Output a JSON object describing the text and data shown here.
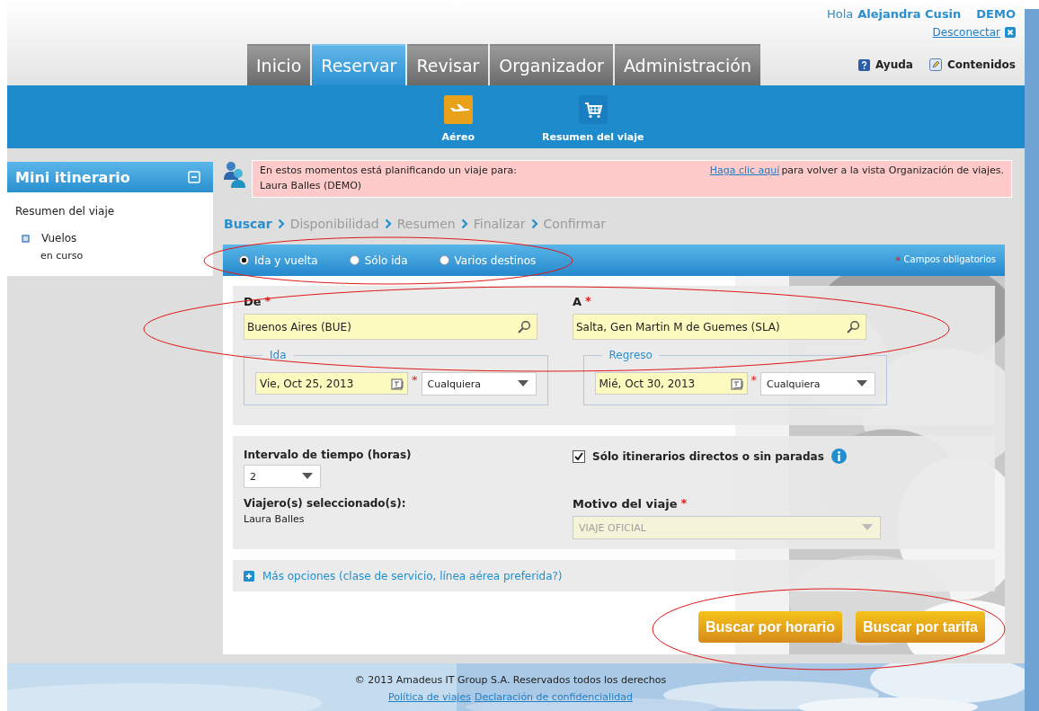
{
  "user": {
    "greeting": "Hola",
    "name": "Alejandra Cusin",
    "company": "DEMO",
    "logout": "Desconectar"
  },
  "tabs": [
    {
      "label": "Inicio",
      "selected": false
    },
    {
      "label": "Reservar",
      "selected": true
    },
    {
      "label": "Revisar",
      "selected": false
    },
    {
      "label": "Organizador",
      "selected": false
    },
    {
      "label": "Administración",
      "selected": false
    }
  ],
  "help_links": [
    {
      "kind": "help",
      "label": "Ayuda"
    },
    {
      "kind": "contents",
      "label": "Contenidos"
    }
  ],
  "subnav": [
    {
      "kind": "flight",
      "label": "Aéreo",
      "selected": true
    },
    {
      "kind": "cart",
      "label": "Resumen del viaje",
      "selected": false
    }
  ],
  "sidebar": {
    "title": "Mini itinerario",
    "summary": "Resumen del viaje",
    "items": [
      {
        "label": "Vuelos",
        "status": "en curso"
      }
    ]
  },
  "notice": {
    "line1": "En estos momentos está planificando un viaje para:",
    "line2": "Laura Balles  (DEMO)",
    "link": "Haga clic  aquí",
    "after": "para volver a la vista Organización de viajes."
  },
  "steps": [
    {
      "label": "Buscar",
      "selected": true
    },
    {
      "label": "Disponibilidad",
      "selected": false
    },
    {
      "label": "Resumen",
      "selected": false
    },
    {
      "label": "Finalizar",
      "selected": false
    },
    {
      "label": "Confirmar",
      "selected": false
    }
  ],
  "trip_types": [
    {
      "label": "Ida y vuelta",
      "selected": true
    },
    {
      "label": "Sólo ida",
      "selected": false
    },
    {
      "label": "Varios destinos",
      "selected": false
    }
  ],
  "required_note": {
    "mark": "*",
    "label": "Campos obligatorios"
  },
  "from": {
    "label": "De",
    "required_mark": "*",
    "value": "Buenos Aires (BUE)"
  },
  "to": {
    "label": "A",
    "required_mark": "*",
    "value": "Salta, Gen Martin M de Guemes (SLA)"
  },
  "legs": [
    {
      "legend": "Ida",
      "date": "Vie, Oct 25, 2013",
      "required_mark": "*",
      "time": "Cualquiera"
    },
    {
      "legend": "Regreso",
      "date": "Mié, Oct 30, 2013",
      "required_mark": "*",
      "time": "Cualquiera"
    }
  ],
  "interval": {
    "label": "Intervalo de tiempo (horas)",
    "value": "2"
  },
  "direct_only": {
    "label": "Sólo itinerarios directos o sin paradas",
    "checked": true
  },
  "travelers": {
    "label": "Viajero(s) seleccionado(s):",
    "value": "Laura Balles"
  },
  "reason": {
    "label": "Motivo del viaje",
    "required_mark": "*",
    "value": "VIAJE OFICIAL",
    "disabled": true
  },
  "more_options": "Más opciones (clase de servicio, línea aérea preferida?)",
  "buttons": [
    {
      "label": "Buscar por horario"
    },
    {
      "label": "Buscar por tarifa"
    }
  ],
  "footer": {
    "copyright": "© 2013 Amadeus IT Group S.A. Reservados todos los derechos",
    "links": [
      "Política de viajes",
      "Declaración de confidencialidad"
    ]
  },
  "annotations": [
    {
      "kind": "ellipse"
    },
    {
      "kind": "ellipse"
    },
    {
      "kind": "ellipse"
    }
  ]
}
